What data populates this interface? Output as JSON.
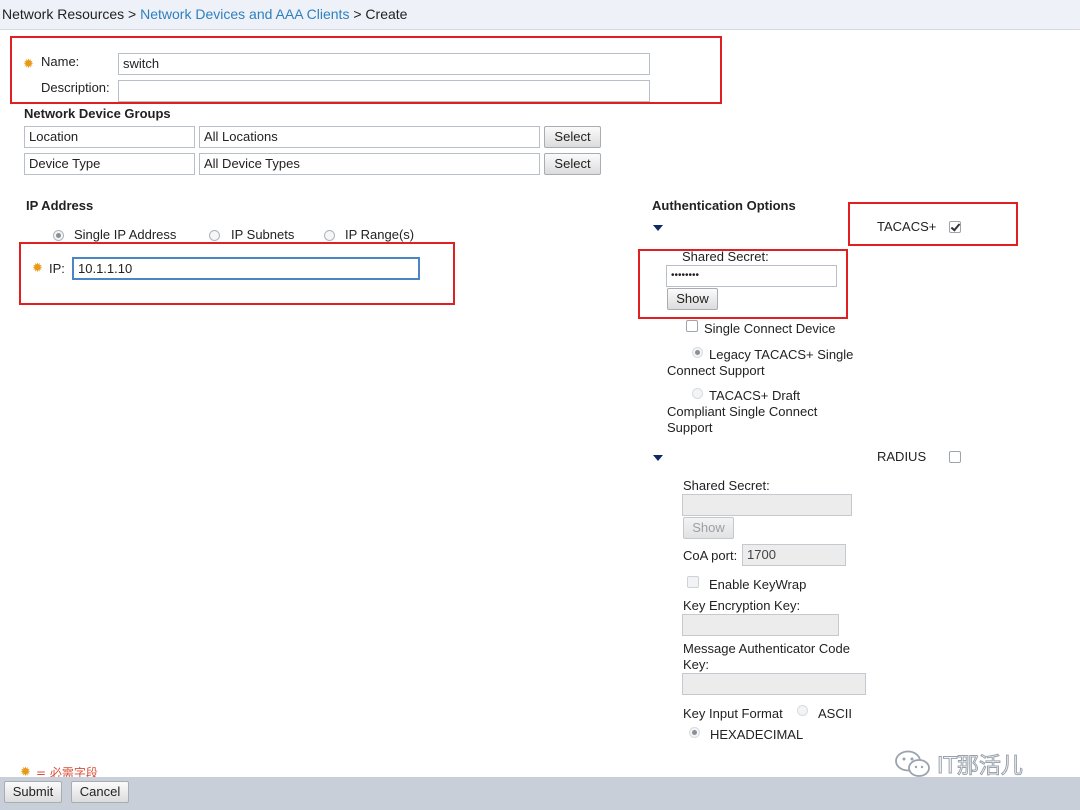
{
  "breadcrumb": {
    "root": "Network Resources",
    "sep": ">",
    "link": "Network Devices and AAA Clients",
    "current": "Create"
  },
  "general": {
    "name_label": "Name:",
    "name_value": "switch",
    "description_label": "Description:",
    "description_value": ""
  },
  "ndg": {
    "title": "Network Device Groups",
    "rows": [
      {
        "key": "Location",
        "value": "All Locations",
        "button": "Select"
      },
      {
        "key": "Device Type",
        "value": "All Device Types",
        "button": "Select"
      }
    ]
  },
  "ip": {
    "title": "IP Address",
    "options": [
      "Single IP Address",
      "IP Subnets",
      "IP Range(s)"
    ],
    "selected": "Single IP Address",
    "ip_label": "IP:",
    "ip_value": "10.1.1.10"
  },
  "auth": {
    "title": "Authentication Options",
    "tacacs": {
      "label": "TACACS+",
      "checked": true,
      "secret_label": "Shared Secret:",
      "secret_value": "••••••••",
      "show": "Show",
      "single_connect": "Single Connect Device",
      "legacy_line1": "Legacy TACACS+ Single",
      "legacy_line2": "Connect Support",
      "draft_line1": "TACACS+ Draft",
      "draft_line2": "Compliant Single Connect",
      "draft_line3": "Support"
    },
    "radius": {
      "label": "RADIUS",
      "checked": false,
      "secret_label": "Shared Secret:",
      "show": "Show",
      "coa_label": "CoA port:",
      "coa_value": "1700",
      "keywrap": "Enable KeyWrap",
      "kek_label": "Key Encryption Key:",
      "mack_line1": "Message Authenticator Code",
      "mack_line2": "Key:",
      "format_label": "Key Input Format",
      "ascii": "ASCII",
      "hex": "HEXADECIMAL"
    }
  },
  "footer": {
    "required_note": "= 必需字段",
    "submit": "Submit",
    "cancel": "Cancel"
  },
  "watermark": "IT那活儿",
  "colors": {
    "link": "#2f7fbf",
    "required_icon": "#e89a16",
    "highlight": "#e02020"
  }
}
